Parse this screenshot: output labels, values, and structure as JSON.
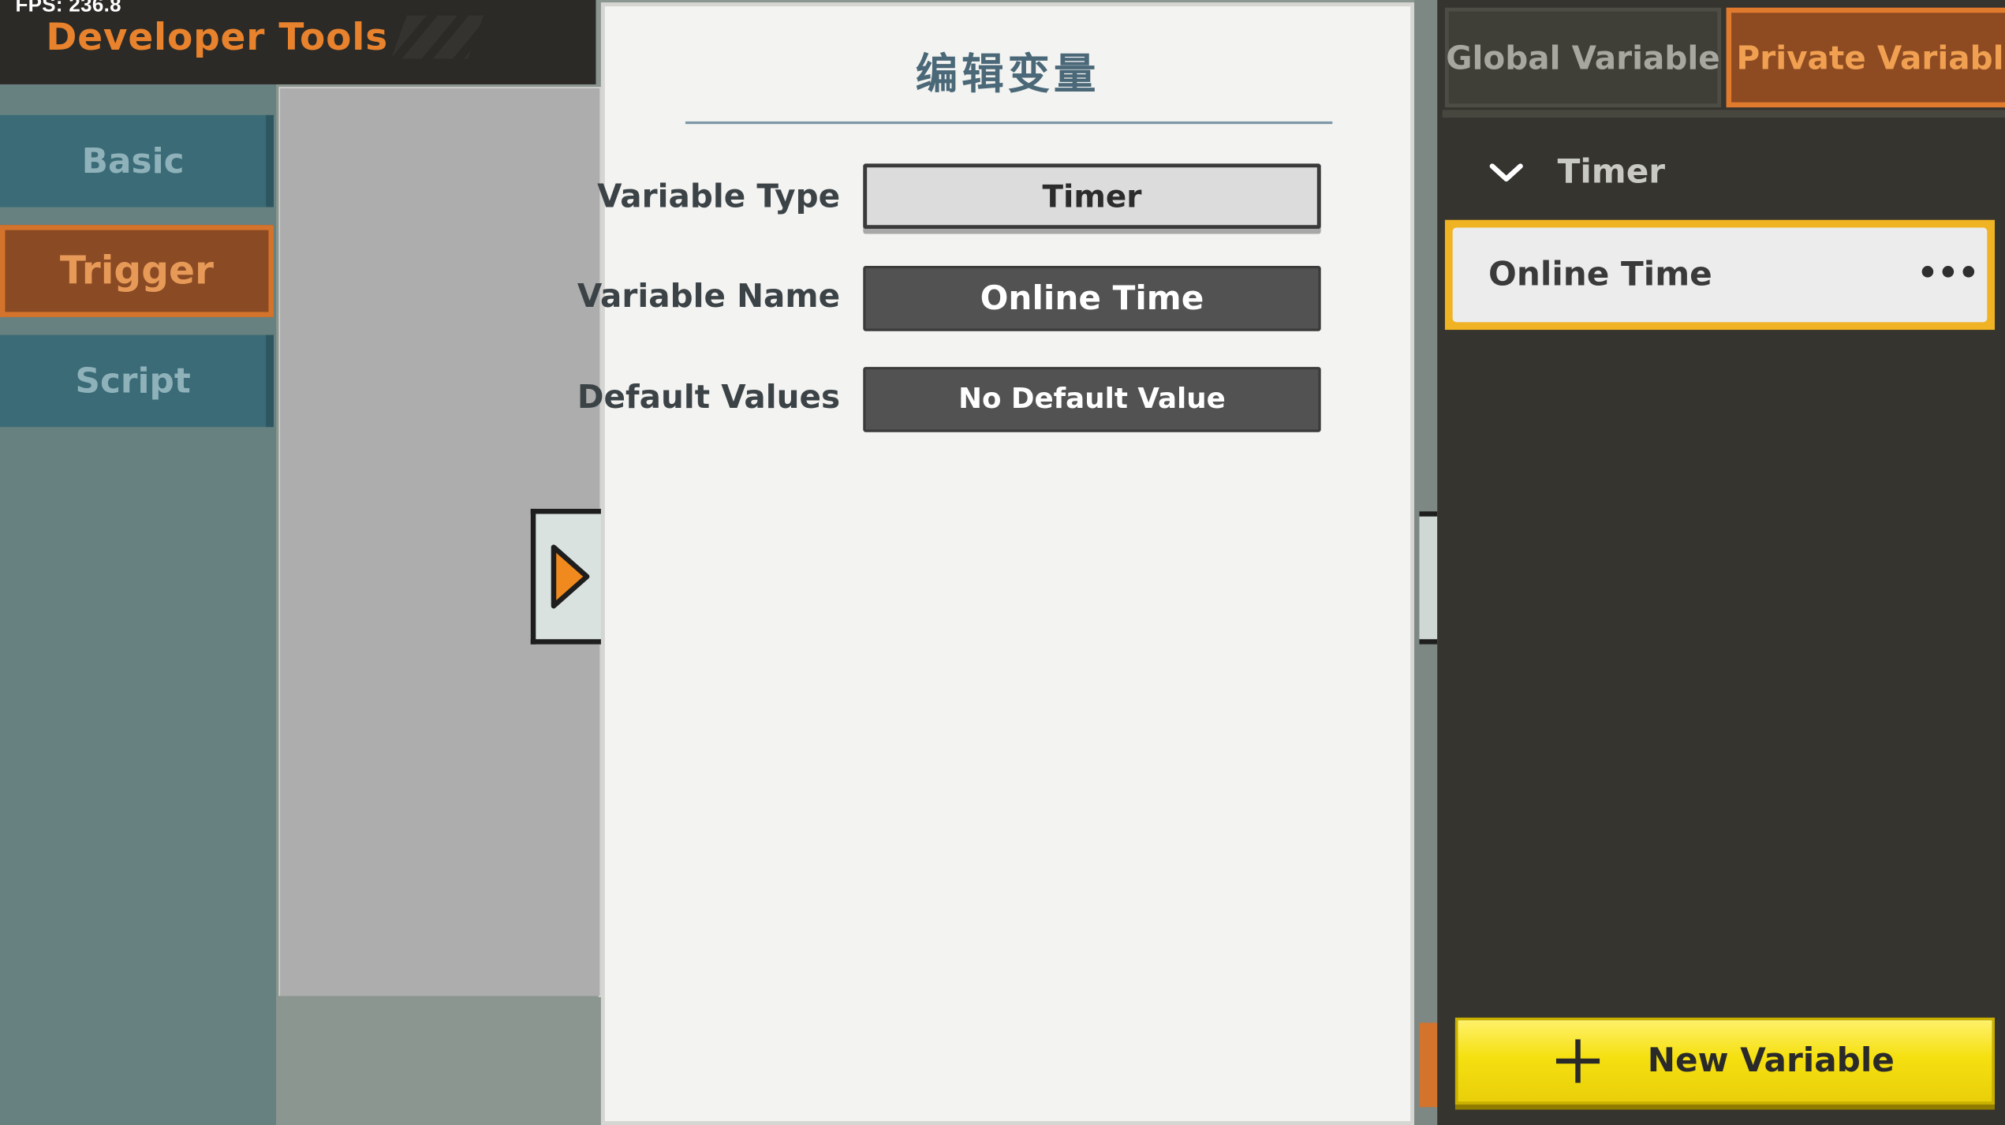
{
  "hud": {
    "fps": "FPS: 236.8"
  },
  "app": {
    "title": "Developer Tools"
  },
  "sidebar": {
    "items": [
      {
        "label": "Basic"
      },
      {
        "label": "Trigger"
      },
      {
        "label": "Script"
      }
    ],
    "active_index": 1
  },
  "modal": {
    "title": "编辑变量",
    "fields": [
      {
        "label": "Variable Type",
        "value": "Timer"
      },
      {
        "label": "Variable Name",
        "value": "Online Time"
      },
      {
        "label": "Default Values",
        "value": "No Default Value"
      }
    ]
  },
  "variables_panel": {
    "tabs": [
      {
        "label": "Global Variable"
      },
      {
        "label": "Private Variable"
      }
    ],
    "active_tab": "Private Variable",
    "group": {
      "label": "Timer",
      "expanded": true
    },
    "items": [
      {
        "name": "Online Time",
        "selected": true
      }
    ],
    "new_button_label": "New Variable"
  },
  "colors": {
    "accent_orange": "#e07a2c",
    "selection_yellow": "#f0b323",
    "primary_button_yellow": "#f5e011",
    "sidebar_teal": "#3a6b77"
  },
  "icons": {
    "play_toggle": "play-triangle-icon",
    "group_toggle": "chevron-down-icon",
    "item_menu": "more-horizontal-icon",
    "add": "plus-icon"
  }
}
